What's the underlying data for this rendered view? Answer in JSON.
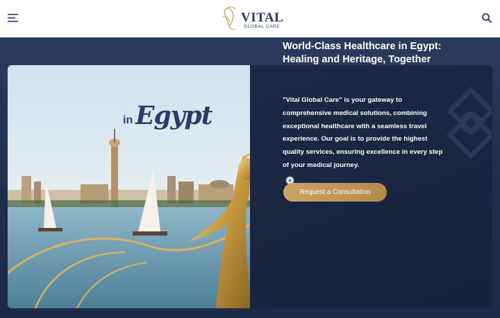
{
  "header": {
    "logo_title": "VITAL",
    "logo_subtitle": "GLOBAL CARE",
    "menu_icon": "menu-icon",
    "search_icon": "search-icon"
  },
  "hero": {
    "image_heading_prefix": "in",
    "image_heading": "Egypt",
    "title": "World-Class Healthcare in Egypt: Healing and Heritage, Together",
    "body": "\"Vital Global Care\" is your gateway to comprehensive medical solutions, combining exceptional healthcare with a seamless travel experience. Our goal is to provide the highest quality services, ensuring excellence in every step of your medical journey.",
    "cta_label": "Request a Consultation"
  },
  "colors": {
    "navy": "#1b2744",
    "gold": "#c9a566",
    "logo_navy": "#2b3a63"
  }
}
